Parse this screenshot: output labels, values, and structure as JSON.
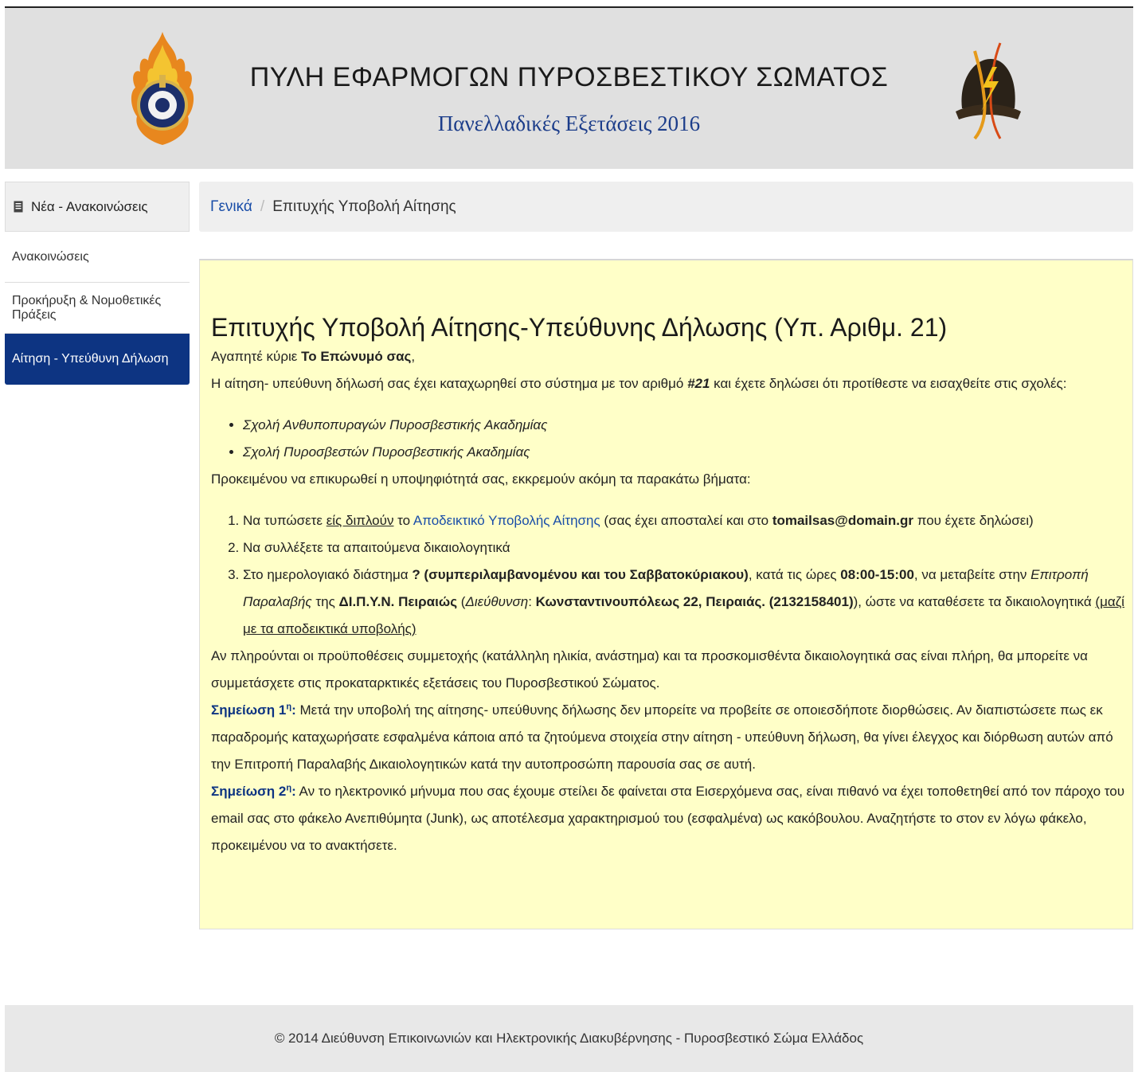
{
  "header": {
    "title": "ΠΥΛΗ ΕΦΑΡΜΟΓΩΝ ΠΥΡΟΣΒΕΣΤΙΚΟΥ ΣΩΜΑΤΟΣ",
    "subtitle": "Πανελλαδικές Εξετάσεις 2016",
    "left_logo_icon": "fire-service-emblem-icon",
    "right_logo_icon": "firefighter-helmet-icon"
  },
  "sidebar": {
    "header_label": "Νέα - Ανακοινώσεις",
    "header_icon": "document-icon",
    "items": [
      {
        "label": "Ανακοινώσεις"
      },
      {
        "label": "Προκήρυξη & Νομοθετικές Πράξεις"
      },
      {
        "label": "Αίτηση - Υπεύθυνη Δήλωση"
      }
    ]
  },
  "breadcrumb": {
    "home": "Γενικά",
    "separator": "/",
    "current": "Επιτυχής Υποβολή Αίτησης"
  },
  "main": {
    "title": "Επιτυχής Υποβολή Αίτησης-Υπεύθυνης Δήλωσης (Υπ. Αριθμ. 21)",
    "greeting_prefix": "Αγαπητέ κύριε ",
    "greeting_name": "Το Επώνυμό σας",
    "greeting_suffix": ",",
    "registered_prefix": "Η αίτηση- υπεύθυνη δήλωσή σας έχει καταχωρηθεί στο σύστημα με τον αριθμό ",
    "registered_number": "#21",
    "registered_suffix": " και έχετε δηλώσει ότι προτίθεστε να εισαχθείτε στις σχολές:",
    "schools": [
      "Σχολή Ανθυποπυραγών Πυροσβεστικής Ακαδημίας",
      "Σχολή Πυροσβεστών Πυροσβεστικής Ακαδημίας"
    ],
    "pending_text": "Προκειμένου να επικυρωθεί η υποψηφιότητά σας, εκκρεμούν ακόμη τα παρακάτω βήματα:",
    "step1": {
      "prefix": "Να τυπώσετε ",
      "underlined": "είς διπλούν",
      "mid": " το ",
      "link": "Αποδεικτικό Υποβολής Αίτησης",
      "after_link": " (σας έχει αποσταλεί και στο ",
      "email": "tomailsas@domain.gr",
      "suffix": " που έχετε δηλώσει)"
    },
    "step2": "Να συλλέξετε τα απαιτούμενα δικαιολογητικά",
    "step3": {
      "prefix": "Στο ημερολογιακό διάστημα ",
      "period": "? (συμπεριλαμβανομένου και του Σαββατοκύριακου)",
      "mid1": ", κατά τις ώρες ",
      "hours": "08:00-15:00",
      "mid2": ", να μεταβείτε στην ",
      "committee": "Επιτροπή Παραλαβής",
      "mid3": " της ",
      "office": "ΔΙ.Π.Υ.Ν. Πειραιώς",
      "paren_open": " (",
      "address_label": "Διεύθυνση",
      "colon": ": ",
      "address": "Κωνσταντινουπόλεως 22, Πειραιάς. (2132158401)",
      "paren_close": "), ώστε να καταθέσετε τα δικαιολογητικά ",
      "underlined": "(μαζί με τα αποδεικτικά υποβολής)"
    },
    "conditions_text": "Αν πληρούνται οι προϋποθέσεις συμμετοχής (κατάλληλη ηλικία, ανάστημα) και τα προσκομισθέντα δικαιολογητικά σας είναι πλήρη, θα μπορείτε να συμμετάσχετε στις προκαταρκτικές εξετάσεις του Πυροσβεστικού Σώματος.",
    "note1": {
      "label": "Σημείωση 1",
      "sup": "η",
      "colon": ":",
      "text": " Μετά την υποβολή της αίτησης- υπεύθυνης δήλωσης δεν μπορείτε να προβείτε σε οποιεσδήποτε διορθώσεις. Αν διαπιστώσετε πως εκ παραδρομής καταχωρήσατε εσφαλμένα κάποια από τα ζητούμενα στοιχεία στην αίτηση - υπεύθυνη δήλωση, θα γίνει έλεγχος και διόρθωση αυτών από την Επιτροπή Παραλαβής Δικαιολογητικών κατά την αυτοπροσώπη παρουσία σας σε αυτή."
    },
    "note2": {
      "label": "Σημείωση 2",
      "sup": "η",
      "colon": ":",
      "text": " Αν το ηλεκτρονικό μήνυμα που σας έχουμε στείλει δε φαίνεται στα Εισερχόμενα σας, είναι πιθανό να έχει τοποθετηθεί από τον πάροχο του email σας στο φάκελο Ανεπιθύμητα (Junk), ως αποτέλεσμα χαρακτηρισμού του (εσφαλμένα) ως κακόβουλου. Αναζητήστε το στον εν λόγω φάκελο, προκειμένου να το ανακτήσετε."
    }
  },
  "footer": {
    "text": "© 2014 Διεύθυνση Επικοινωνιών και Ηλεκτρονικής Διακυβέρνησης - Πυροσβεστικό Σώμα Ελλάδος"
  },
  "colors": {
    "accent": "#0d3482",
    "link": "#1a4ea8",
    "panel_bg": "#ffffc8",
    "header_bg": "#e0e0e0"
  }
}
